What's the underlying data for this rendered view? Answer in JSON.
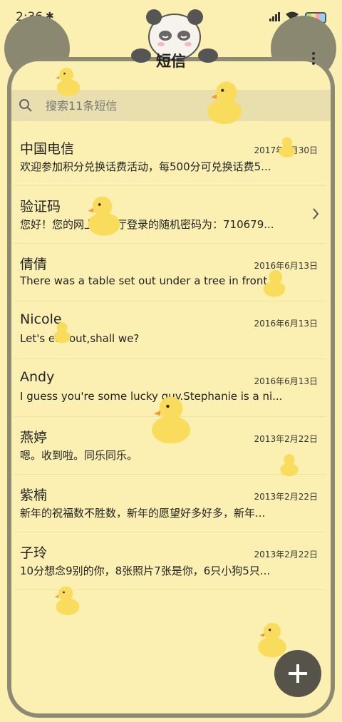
{
  "status_bar": {
    "time": "2:36"
  },
  "header": {
    "title": "短信"
  },
  "search": {
    "placeholder": "搜索11条短信"
  },
  "messages": [
    {
      "name": "中国电信",
      "date": "2017年6月30日",
      "preview": "欢迎参加积分兑换话费活动，每500分可兑换话费5..."
    },
    {
      "name": "验证码",
      "date": "",
      "preview": "您好！您的网上营业厅登录的随机密码为：710679..."
    },
    {
      "name": "倩倩",
      "date": "2016年6月13日",
      "preview": "There was a table set out under a tree in front of ..."
    },
    {
      "name": "Nicole",
      "date": "2016年6月13日",
      "preview": "Let's eat out,shall we?"
    },
    {
      "name": "Andy",
      "date": "2016年6月13日",
      "preview": "I guess you're some lucky guy.Stephanie is a ni..."
    },
    {
      "name": "燕婷",
      "date": "2013年2月22日",
      "preview": "嗯。收到啦。同乐同乐。"
    },
    {
      "name": "紫楠",
      "date": "2013年2月22日",
      "preview": "新年的祝福数不胜数，新年的愿望好多好多，新年..."
    },
    {
      "name": "子玲",
      "date": "2013年2月22日",
      "preview": "10分想念9别的你，8张照片7张是你，6只小狗5只..."
    }
  ],
  "icons": {
    "search": "search-icon",
    "more": "more-vert-icon",
    "chevron": "chevron-right-icon",
    "fab": "plus-icon"
  },
  "colors": {
    "background": "#fbf0b2",
    "frame": "#8d8a74",
    "fab": "#55534a",
    "duck": "#f9dc5c"
  }
}
